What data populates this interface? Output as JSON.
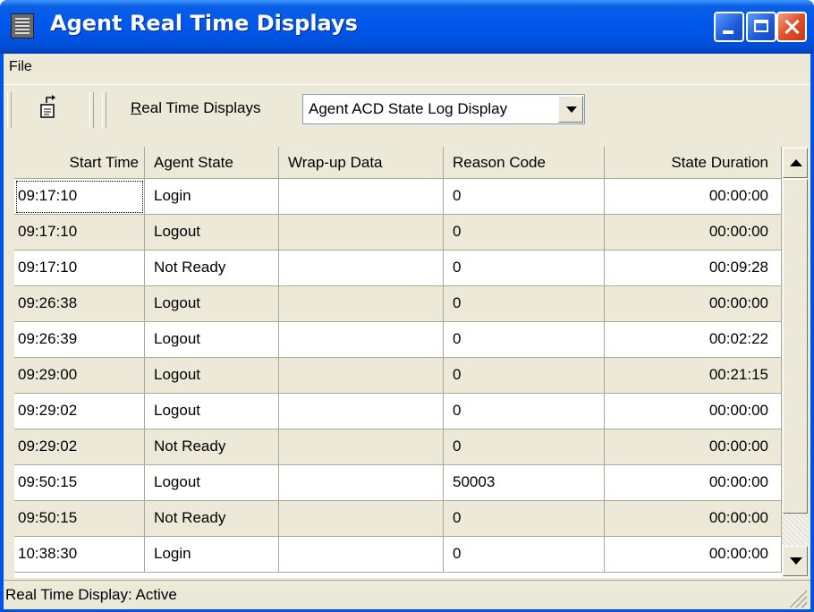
{
  "window": {
    "title": "Agent Real Time Displays"
  },
  "menu": {
    "file": "File"
  },
  "toolbar": {
    "label_prefix": "R",
    "label_rest": "eal Time Displays",
    "combo_value": "Agent ACD State Log Display"
  },
  "table": {
    "headers": [
      "Start Time",
      "Agent State",
      "Wrap-up Data",
      "Reason Code",
      "State Duration"
    ],
    "rows": [
      [
        "09:17:10",
        "Login",
        "",
        "0",
        "00:00:00"
      ],
      [
        "09:17:10",
        "Logout",
        "",
        "0",
        "00:00:00"
      ],
      [
        "09:17:10",
        "Not Ready",
        "",
        "0",
        "00:09:28"
      ],
      [
        "09:26:38",
        "Logout",
        "",
        "0",
        "00:00:00"
      ],
      [
        "09:26:39",
        "Logout",
        "",
        "0",
        "00:02:22"
      ],
      [
        "09:29:00",
        "Logout",
        "",
        "0",
        "00:21:15"
      ],
      [
        "09:29:02",
        "Logout",
        "",
        "0",
        "00:00:00"
      ],
      [
        "09:29:02",
        "Not Ready",
        "",
        "0",
        "00:00:00"
      ],
      [
        "09:50:15",
        "Logout",
        "",
        "50003",
        "00:00:00"
      ],
      [
        "09:50:15",
        "Not Ready",
        "",
        "0",
        "00:00:00"
      ],
      [
        "10:38:30",
        "Login",
        "",
        "0",
        "00:00:00"
      ]
    ],
    "row_colors": {
      "odd": "#ffffff",
      "even": "#ece9d8"
    }
  },
  "status": {
    "text": "Real Time Display: Active"
  },
  "icons": {
    "app": "console-grid-icon",
    "toolbar": "export-page-icon"
  }
}
